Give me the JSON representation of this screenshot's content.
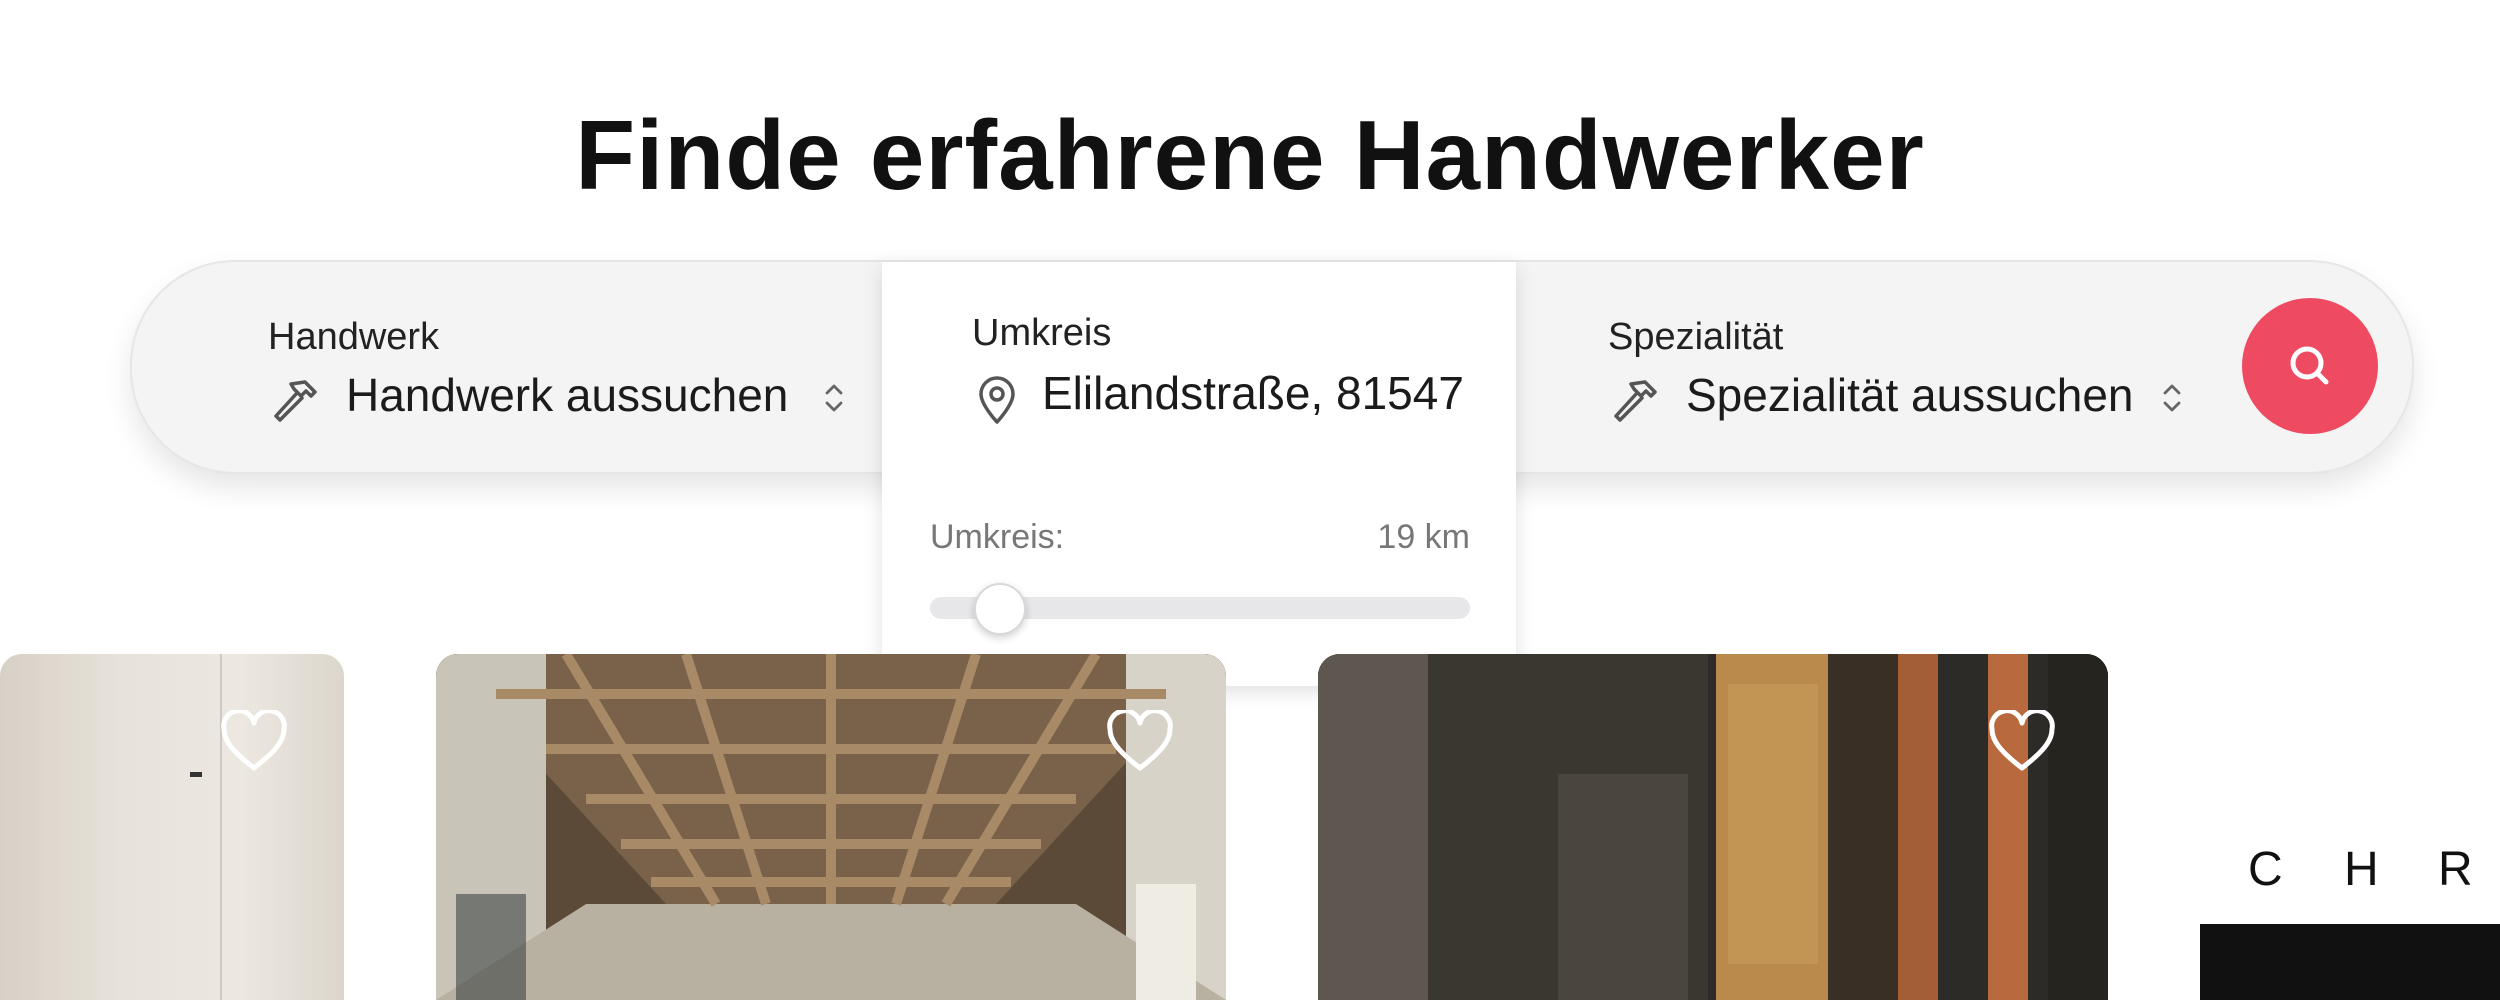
{
  "page": {
    "title": "Finde erfahrene Handwerker"
  },
  "search": {
    "trade": {
      "label": "Handwerk",
      "value": "Handwerk aussuchen",
      "icon": "hammer-icon"
    },
    "radius": {
      "label": "Umkreis",
      "value": "Elilandstraße, 81547",
      "icon": "location-pin-icon"
    },
    "specialty": {
      "label": "Spezialität",
      "value": "Spezialität aussuchen",
      "icon": "hammer-icon"
    },
    "search_icon": "search-icon",
    "accent_color": "#ee4b62"
  },
  "radius_panel": {
    "label": "Umkreis:",
    "value": "19 km",
    "slider_fraction": 0.13
  },
  "cards": [
    {
      "icon": "heart-icon"
    },
    {
      "icon": "heart-icon"
    },
    {
      "icon": "heart-icon"
    }
  ],
  "partial_logo": {
    "letters": [
      "C",
      "H",
      "R"
    ]
  }
}
